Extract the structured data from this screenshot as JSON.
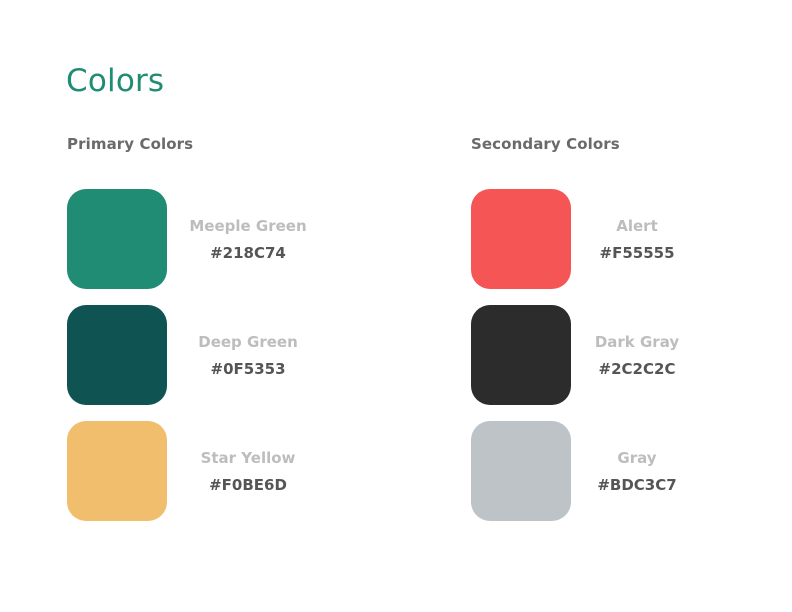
{
  "page": {
    "title": "Colors"
  },
  "primary": {
    "title": "Primary Colors",
    "colors": [
      {
        "name": "Meeple Green",
        "hex": "#218C74"
      },
      {
        "name": "Deep Green",
        "hex": "#0F5353"
      },
      {
        "name": "Star Yellow",
        "hex": "#F0BE6D"
      }
    ]
  },
  "secondary": {
    "title": "Secondary Colors",
    "colors": [
      {
        "name": "Alert",
        "hex": "#F55555"
      },
      {
        "name": "Dark Gray",
        "hex": "#2C2C2C"
      },
      {
        "name": "Gray",
        "hex": "#BDC3C7"
      }
    ]
  }
}
